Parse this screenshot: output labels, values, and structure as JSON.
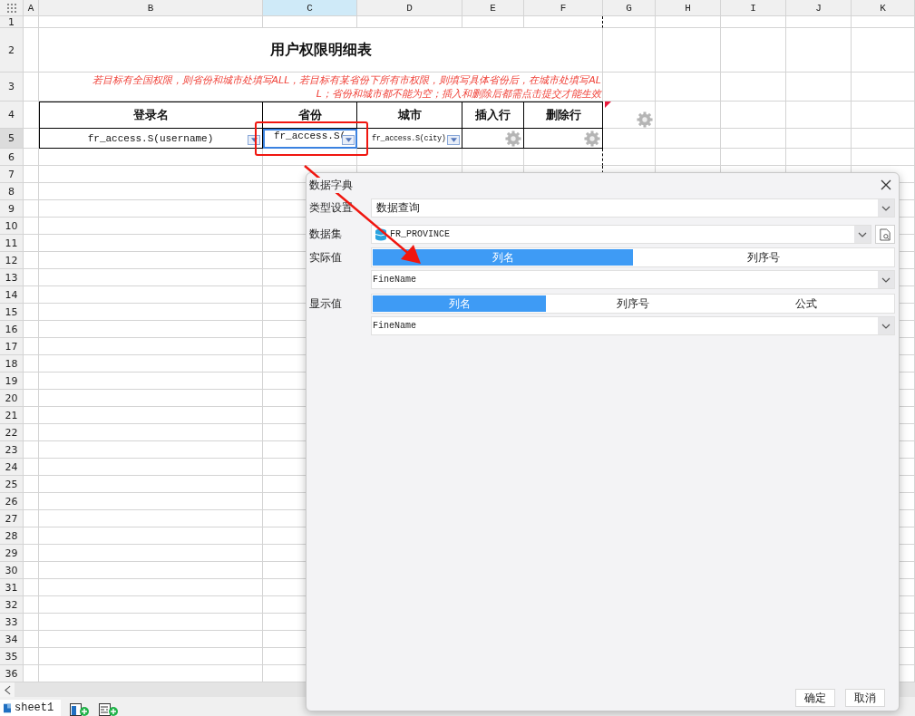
{
  "columns": [
    {
      "label": "A",
      "selected": false
    },
    {
      "label": "B",
      "selected": false
    },
    {
      "label": "C",
      "selected": true
    },
    {
      "label": "D",
      "selected": false
    },
    {
      "label": "E",
      "selected": false
    },
    {
      "label": "F",
      "selected": false
    },
    {
      "label": "G",
      "selected": false
    },
    {
      "label": "H",
      "selected": false
    },
    {
      "label": "I",
      "selected": false
    },
    {
      "label": "J",
      "selected": false
    },
    {
      "label": "K",
      "selected": false
    }
  ],
  "rows": [
    {
      "label": "1",
      "selected": false
    },
    {
      "label": "2",
      "selected": false
    },
    {
      "label": "3",
      "selected": false
    },
    {
      "label": "4",
      "selected": false
    },
    {
      "label": "5",
      "selected": true
    },
    {
      "label": "6",
      "selected": false
    },
    {
      "label": "7",
      "selected": false
    },
    {
      "label": "8",
      "selected": false
    },
    {
      "label": "9",
      "selected": false
    },
    {
      "label": "10",
      "selected": false
    },
    {
      "label": "11",
      "selected": false
    },
    {
      "label": "12",
      "selected": false
    },
    {
      "label": "13",
      "selected": false
    },
    {
      "label": "14",
      "selected": false
    },
    {
      "label": "15",
      "selected": false
    },
    {
      "label": "16",
      "selected": false
    },
    {
      "label": "17",
      "selected": false
    },
    {
      "label": "18",
      "selected": false
    },
    {
      "label": "19",
      "selected": false
    },
    {
      "label": "20",
      "selected": false
    },
    {
      "label": "21",
      "selected": false
    },
    {
      "label": "22",
      "selected": false
    },
    {
      "label": "23",
      "selected": false
    },
    {
      "label": "24",
      "selected": false
    },
    {
      "label": "25",
      "selected": false
    },
    {
      "label": "26",
      "selected": false
    },
    {
      "label": "27",
      "selected": false
    },
    {
      "label": "28",
      "selected": false
    },
    {
      "label": "29",
      "selected": false
    },
    {
      "label": "30",
      "selected": false
    },
    {
      "label": "31",
      "selected": false
    },
    {
      "label": "32",
      "selected": false
    },
    {
      "label": "33",
      "selected": false
    },
    {
      "label": "34",
      "selected": false
    },
    {
      "label": "35",
      "selected": false
    },
    {
      "label": "36",
      "selected": false
    }
  ],
  "sheet": {
    "title": "用户权限明细表",
    "note_lines": [
      "若目标有全国权限，则省份和城市处填写ALL，若目标有某省份下所有市权限，则填写具体省份后，在城市处填写AL",
      "L；省份和城市都不能为空；插入和删除后都需点击提交才能生效"
    ],
    "headers": [
      "登录名",
      "省份",
      "城市",
      "插入行",
      "删除行"
    ],
    "cells": [
      {
        "kind": "dropdown",
        "text": "fr_access.S(username)",
        "selected": false
      },
      {
        "kind": "dropdown",
        "text": "fr_access.S(",
        "selected": true
      },
      {
        "kind": "dropdown",
        "text": "fr_access.S(city)",
        "selected": false
      },
      {
        "kind": "gear",
        "selected": false
      },
      {
        "kind": "gear",
        "selected": false
      }
    ]
  },
  "sheet_tabs": [
    {
      "label": "sheet1",
      "selected": true
    }
  ],
  "dialog": {
    "title": "数据字典",
    "type_label": "类型设置",
    "type_value": "数据查询",
    "dataset_label": "数据集",
    "dataset_value": "FR_PROVINCE",
    "actual_label": "实际值",
    "actual_tabs": [
      {
        "label": "列名",
        "selected": true
      },
      {
        "label": "列序号",
        "selected": false
      }
    ],
    "actual_value": "FineName",
    "display_label": "显示值",
    "display_tabs": [
      {
        "label": "列名",
        "selected": true
      },
      {
        "label": "列序号",
        "selected": false
      },
      {
        "label": "公式",
        "selected": false
      }
    ],
    "display_value": "FineName",
    "buttons": [
      "确定",
      "取消"
    ]
  }
}
